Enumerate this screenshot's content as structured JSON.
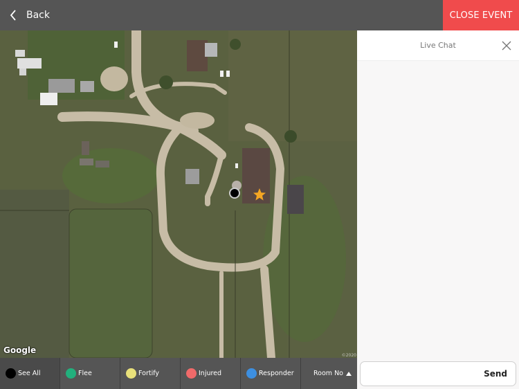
{
  "topbar": {
    "back_label": "Back",
    "back_icon": "chevron-left-icon",
    "close_event_label": "CLOSE EVENT",
    "close_event_color": "#f04b4c"
  },
  "map": {
    "provider_logo": "Google",
    "copyright": "©2020",
    "markers": [
      {
        "type": "star",
        "color": "#f5a623",
        "icon": "star-icon"
      },
      {
        "type": "circle",
        "color": "#000000",
        "icon": "circle-marker"
      }
    ]
  },
  "filters": [
    {
      "label": "See All",
      "color": "#000000",
      "active": true
    },
    {
      "label": "Flee",
      "color": "#22b07d",
      "active": false
    },
    {
      "label": "Fortify",
      "color": "#e8e07a",
      "active": false
    },
    {
      "label": "Injured",
      "color": "#f06a6a",
      "active": false
    },
    {
      "label": "Responder",
      "color": "#3d8fe0",
      "active": false
    }
  ],
  "sort": {
    "label": "Room No",
    "direction": "ascending"
  },
  "chat": {
    "title": "Live Chat",
    "close_icon": "close-icon",
    "input_value": "",
    "input_placeholder": "",
    "send_label": "Send",
    "messages": []
  }
}
